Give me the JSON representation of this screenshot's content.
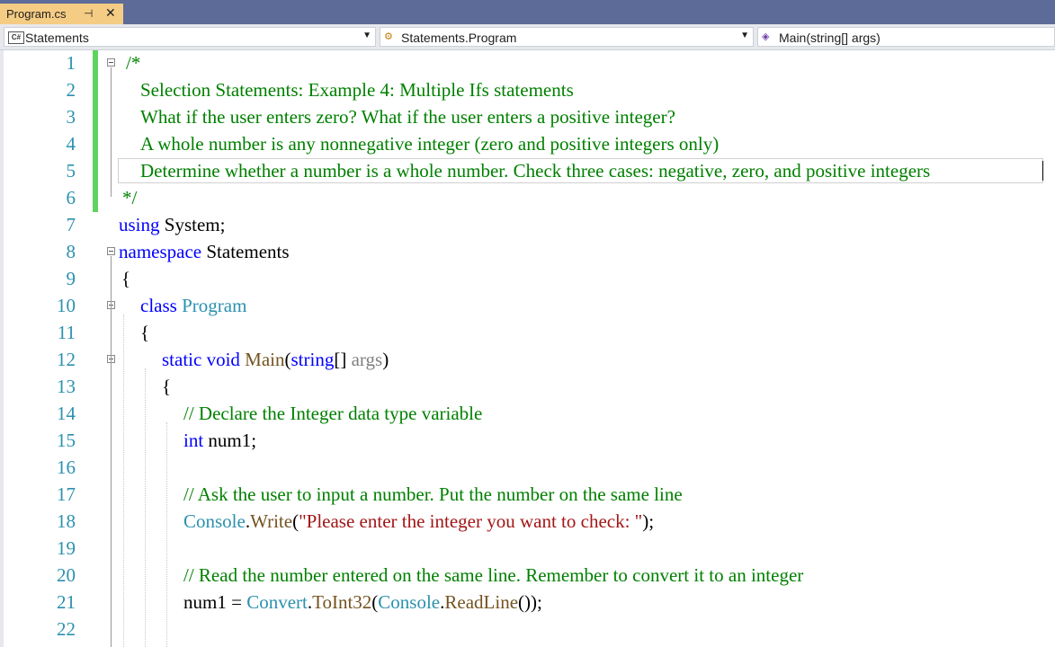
{
  "tab": {
    "title": "Program.cs",
    "pin_icon": "pin-icon",
    "close_icon": "close-icon"
  },
  "nav": {
    "project": "Statements",
    "type": "Statements.Program",
    "member": "Main(string[] args)"
  },
  "lines": [
    {
      "n": "1",
      "segments": [
        {
          "t": "/*",
          "c": "com"
        }
      ]
    },
    {
      "n": "2",
      "segments": [
        {
          "t": "Selection Statements: Example 4: Multiple Ifs statements",
          "c": "com"
        }
      ]
    },
    {
      "n": "3",
      "segments": [
        {
          "t": "What if the user enters zero? What if the user enters a positive integer?",
          "c": "com"
        }
      ]
    },
    {
      "n": "4",
      "segments": [
        {
          "t": "A whole number is any nonnegative integer (zero and positive integers only)",
          "c": "com"
        }
      ]
    },
    {
      "n": "5",
      "segments": [
        {
          "t": "Determine whether a number is a whole number. Check three cases: negative, zero, and positive integers",
          "c": "com"
        }
      ]
    },
    {
      "n": "6",
      "segments": [
        {
          "t": "*/",
          "c": "com"
        }
      ]
    },
    {
      "n": "7",
      "segments": [
        {
          "t": "using",
          "c": "kw"
        },
        {
          "t": " System;",
          "c": ""
        }
      ]
    },
    {
      "n": "8",
      "segments": [
        {
          "t": "namespace",
          "c": "kw"
        },
        {
          "t": " Statements",
          "c": ""
        }
      ]
    },
    {
      "n": "9",
      "segments": [
        {
          "t": "{",
          "c": ""
        }
      ]
    },
    {
      "n": "10",
      "segments": [
        {
          "t": "class",
          "c": "kw"
        },
        {
          "t": " ",
          "c": ""
        },
        {
          "t": "Program",
          "c": "ty"
        }
      ]
    },
    {
      "n": "11",
      "segments": [
        {
          "t": "{",
          "c": ""
        }
      ]
    },
    {
      "n": "12",
      "segments": [
        {
          "t": "static",
          "c": "kw"
        },
        {
          "t": " ",
          "c": ""
        },
        {
          "t": "void",
          "c": "kw"
        },
        {
          "t": " ",
          "c": ""
        },
        {
          "t": "Main",
          "c": "me"
        },
        {
          "t": "(",
          "c": ""
        },
        {
          "t": "string",
          "c": "kw"
        },
        {
          "t": "[] ",
          "c": ""
        },
        {
          "t": "args",
          "c": "pa"
        },
        {
          "t": ")",
          "c": ""
        }
      ]
    },
    {
      "n": "13",
      "segments": [
        {
          "t": "{",
          "c": ""
        }
      ]
    },
    {
      "n": "14",
      "segments": [
        {
          "t": "// Declare the Integer data type variable",
          "c": "com"
        }
      ]
    },
    {
      "n": "15",
      "segments": [
        {
          "t": "int",
          "c": "kw"
        },
        {
          "t": " num1;",
          "c": ""
        }
      ]
    },
    {
      "n": "16",
      "segments": []
    },
    {
      "n": "17",
      "segments": [
        {
          "t": "// Ask the user to input a number. Put the number on the same line",
          "c": "com"
        }
      ]
    },
    {
      "n": "18",
      "segments": [
        {
          "t": "Console",
          "c": "ty"
        },
        {
          "t": ".",
          "c": ""
        },
        {
          "t": "Write",
          "c": "me"
        },
        {
          "t": "(",
          "c": ""
        },
        {
          "t": "\"Please enter the integer you want to check: \"",
          "c": "st"
        },
        {
          "t": ");",
          "c": ""
        }
      ]
    },
    {
      "n": "19",
      "segments": []
    },
    {
      "n": "20",
      "segments": [
        {
          "t": "// Read the number entered on the same line. Remember to convert it to an integer",
          "c": "com"
        }
      ]
    },
    {
      "n": "21",
      "segments": [
        {
          "t": "num1 = ",
          "c": ""
        },
        {
          "t": "Convert",
          "c": "ty"
        },
        {
          "t": ".",
          "c": ""
        },
        {
          "t": "ToInt32",
          "c": "me"
        },
        {
          "t": "(",
          "c": ""
        },
        {
          "t": "Console",
          "c": "ty"
        },
        {
          "t": ".",
          "c": ""
        },
        {
          "t": "ReadLine",
          "c": "me"
        },
        {
          "t": "());",
          "c": ""
        }
      ]
    },
    {
      "n": "22",
      "segments": []
    }
  ],
  "colors": {
    "tabstrip": "#5d6b99",
    "active_tab": "#f5cc84",
    "comment": "#008000",
    "keyword": "#0000ff",
    "type": "#2b91af",
    "method": "#74531f",
    "string": "#a31515",
    "change_margin": "#5fd35f"
  }
}
